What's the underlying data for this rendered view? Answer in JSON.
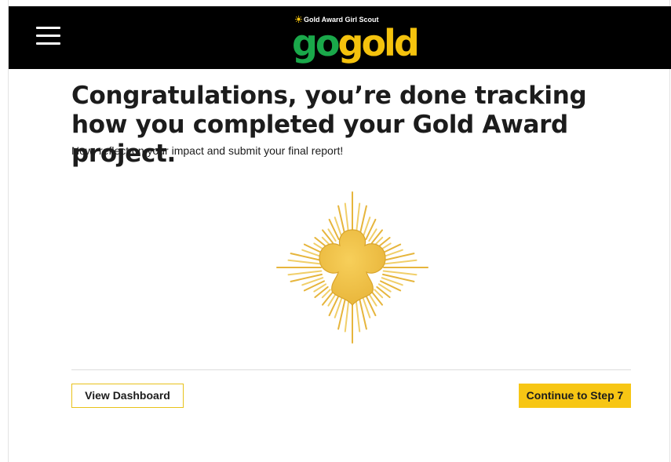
{
  "header": {
    "menu_icon": "hamburger-menu-icon",
    "logo": {
      "tagline": "Gold Award Girl Scout",
      "word_go": "go",
      "word_gold": "gold",
      "go_color": "#1aa84a",
      "gold_color": "#f4c20d"
    },
    "background_color": "#000000"
  },
  "main": {
    "headline": "Congratulations, you’re done tracking how you completed your Gold Award project.",
    "subtext": "Now, reflect on your impact and submit your final report!",
    "badge_icon": "gold-award-trefoil-sunburst-icon"
  },
  "actions": {
    "view_dashboard_label": "View Dashboard",
    "continue_label": "Continue to Step 7",
    "primary_color": "#f7c614"
  }
}
